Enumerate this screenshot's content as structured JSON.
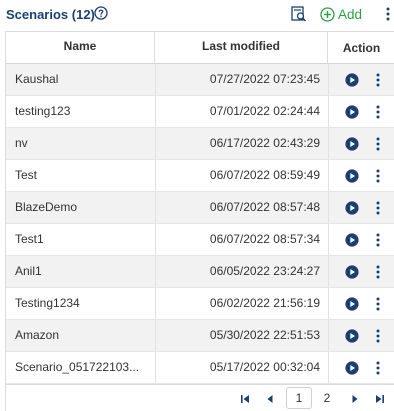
{
  "header": {
    "title": "Scenarios (12)",
    "add_label": "Add",
    "accent_color": "#1a3f73",
    "add_color": "#2e9e44"
  },
  "table": {
    "columns": {
      "name": "Name",
      "last_modified": "Last modified",
      "action": "Action"
    },
    "rows": [
      {
        "name": "Kaushal",
        "last_modified": "07/27/2022 07:23:45"
      },
      {
        "name": "testing123",
        "last_modified": "07/01/2022 02:24:44"
      },
      {
        "name": "nv",
        "last_modified": "06/17/2022 02:43:29"
      },
      {
        "name": "Test",
        "last_modified": "06/07/2022 08:59:49"
      },
      {
        "name": "BlazeDemo",
        "last_modified": "06/07/2022 08:57:48"
      },
      {
        "name": "Test1",
        "last_modified": "06/07/2022 08:57:34"
      },
      {
        "name": "Anil1",
        "last_modified": "06/05/2022 23:24:27"
      },
      {
        "name": "Testing1234",
        "last_modified": "06/02/2022 21:56:19"
      },
      {
        "name": "Amazon",
        "last_modified": "05/30/2022 22:51:53"
      },
      {
        "name": "Scenario_051722103...",
        "last_modified": "05/17/2022 00:32:04"
      }
    ]
  },
  "pagination": {
    "current_page": "1",
    "next_page": "2"
  },
  "icons": {
    "help": "question-circle-icon",
    "search": "search-list-icon",
    "add": "plus-circle-icon",
    "run": "play-circle-icon",
    "more": "kebab-menu-icon",
    "first": "first-page-icon",
    "prev": "prev-page-icon",
    "next": "next-page-icon",
    "last": "last-page-icon"
  }
}
